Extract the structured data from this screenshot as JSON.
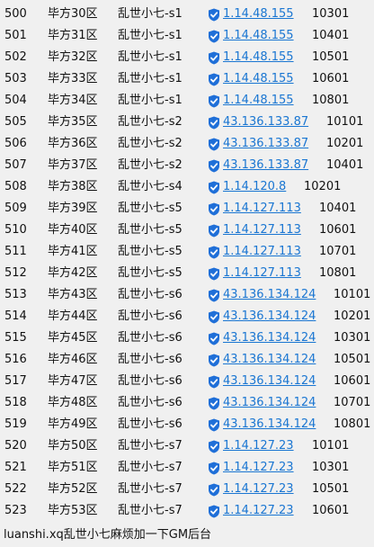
{
  "rows": [
    {
      "id": "500",
      "zone": "毕方30区",
      "server": "乱世小七-s1",
      "ip": "1.14.48.155",
      "port": "10301"
    },
    {
      "id": "501",
      "zone": "毕方31区",
      "server": "乱世小七-s1",
      "ip": "1.14.48.155",
      "port": "10401"
    },
    {
      "id": "502",
      "zone": "毕方32区",
      "server": "乱世小七-s1",
      "ip": "1.14.48.155",
      "port": "10501"
    },
    {
      "id": "503",
      "zone": "毕方33区",
      "server": "乱世小七-s1",
      "ip": "1.14.48.155",
      "port": "10601"
    },
    {
      "id": "504",
      "zone": "毕方34区",
      "server": "乱世小七-s1",
      "ip": "1.14.48.155",
      "port": "10801"
    },
    {
      "id": "505",
      "zone": "毕方35区",
      "server": "乱世小七-s2",
      "ip": "43.136.133.87",
      "port": "10101"
    },
    {
      "id": "506",
      "zone": "毕方36区",
      "server": "乱世小七-s2",
      "ip": "43.136.133.87",
      "port": "10201"
    },
    {
      "id": "507",
      "zone": "毕方37区",
      "server": "乱世小七-s2",
      "ip": "43.136.133.87",
      "port": "10401"
    },
    {
      "id": "508",
      "zone": "毕方38区",
      "server": "乱世小七-s4",
      "ip": "1.14.120.8",
      "port": "10201"
    },
    {
      "id": "509",
      "zone": "毕方39区",
      "server": "乱世小七-s5",
      "ip": "1.14.127.113",
      "port": "10401"
    },
    {
      "id": "510",
      "zone": "毕方40区",
      "server": "乱世小七-s5",
      "ip": "1.14.127.113",
      "port": "10601"
    },
    {
      "id": "511",
      "zone": "毕方41区",
      "server": "乱世小七-s5",
      "ip": "1.14.127.113",
      "port": "10701"
    },
    {
      "id": "512",
      "zone": "毕方42区",
      "server": "乱世小七-s5",
      "ip": "1.14.127.113",
      "port": "10801"
    },
    {
      "id": "513",
      "zone": "毕方43区",
      "server": "乱世小七-s6",
      "ip": "43.136.134.124",
      "port": "10101"
    },
    {
      "id": "514",
      "zone": "毕方44区",
      "server": "乱世小七-s6",
      "ip": "43.136.134.124",
      "port": "10201"
    },
    {
      "id": "515",
      "zone": "毕方45区",
      "server": "乱世小七-s6",
      "ip": "43.136.134.124",
      "port": "10301"
    },
    {
      "id": "516",
      "zone": "毕方46区",
      "server": "乱世小七-s6",
      "ip": "43.136.134.124",
      "port": "10501"
    },
    {
      "id": "517",
      "zone": "毕方47区",
      "server": "乱世小七-s6",
      "ip": "43.136.134.124",
      "port": "10601"
    },
    {
      "id": "518",
      "zone": "毕方48区",
      "server": "乱世小七-s6",
      "ip": "43.136.134.124",
      "port": "10701"
    },
    {
      "id": "519",
      "zone": "毕方49区",
      "server": "乱世小七-s6",
      "ip": "43.136.134.124",
      "port": "10801"
    },
    {
      "id": "520",
      "zone": "毕方50区",
      "server": "乱世小七-s7",
      "ip": "1.14.127.23",
      "port": "10101"
    },
    {
      "id": "521",
      "zone": "毕方51区",
      "server": "乱世小七-s7",
      "ip": "1.14.127.23",
      "port": "10301"
    },
    {
      "id": "522",
      "zone": "毕方52区",
      "server": "乱世小七-s7",
      "ip": "1.14.127.23",
      "port": "10501"
    },
    {
      "id": "523",
      "zone": "毕方53区",
      "server": "乱世小七-s7",
      "ip": "1.14.127.23",
      "port": "10601"
    }
  ],
  "footer": {
    "text": "luanshi.xq乱世小七麻烦加一下GM后台"
  },
  "icons": {
    "shield": "shield-check-icon"
  },
  "colors": {
    "link": "#1a76d2",
    "shield": "#1f6fd8",
    "background": "#f0f0f0"
  }
}
